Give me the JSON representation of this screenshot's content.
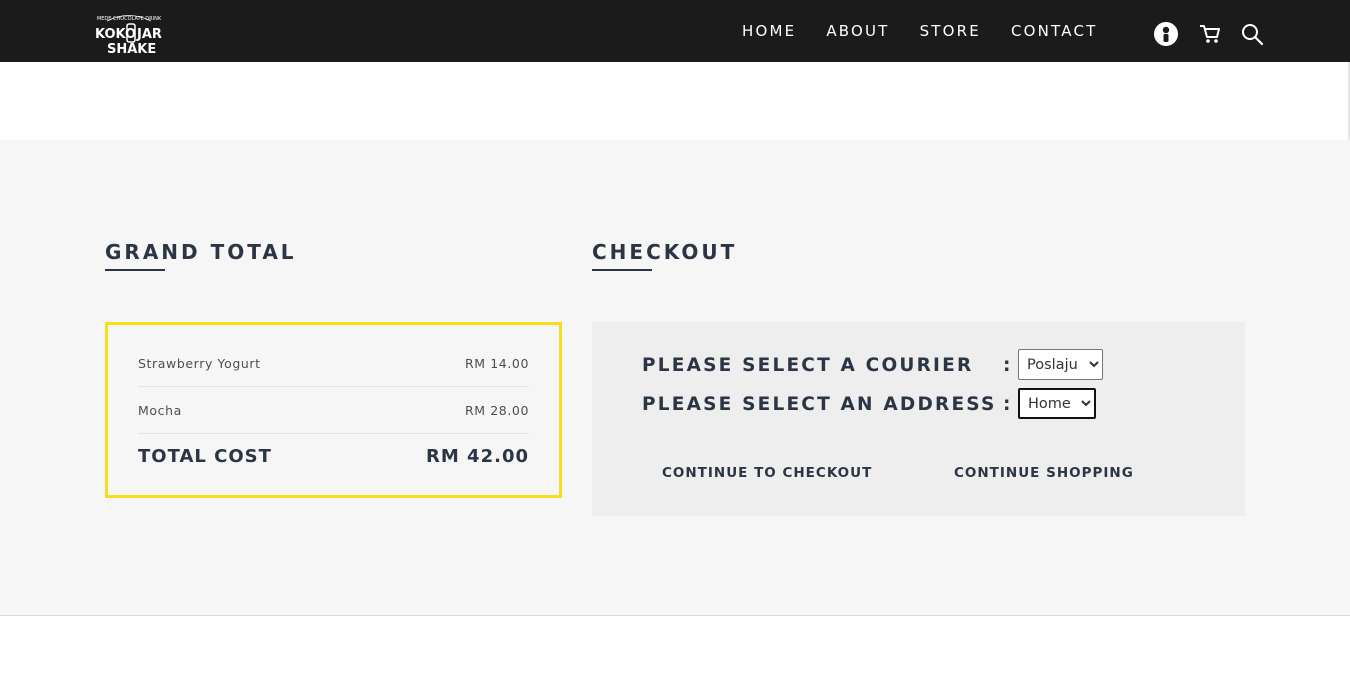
{
  "header": {
    "logo_text": "KOKO JAR SHAKE",
    "logo_tagline": "MEDE CHOCOLATE DRINK",
    "nav": [
      "HOME",
      "ABOUT",
      "STORE",
      "CONTACT"
    ],
    "icons": [
      "user-icon",
      "cart-icon",
      "search-icon"
    ]
  },
  "grand_total": {
    "heading": "GRAND TOTAL",
    "items": [
      {
        "name": "Strawberry Yogurt",
        "price": "RM 14.00"
      },
      {
        "name": "Mocha",
        "price": "RM 28.00"
      }
    ],
    "total_label": "TOTAL COST",
    "total_value": "RM 42.00",
    "border_color": "#f7dd1c"
  },
  "checkout": {
    "heading": "CHECKOUT",
    "courier_label": "PLEASE SELECT A COURIER",
    "courier_value": "Poslaju",
    "address_label": "PLEASE SELECT AN ADDRESS",
    "address_value": "Home",
    "separator": ":",
    "continue_checkout": "CONTINUE TO CHECKOUT",
    "continue_shopping": "CONTINUE SHOPPING"
  }
}
